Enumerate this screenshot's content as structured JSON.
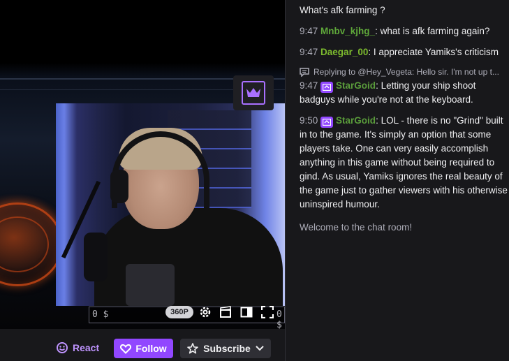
{
  "player": {
    "quality_badge": "360P",
    "hud_left": "0 $",
    "hud_right": "0 $",
    "icons": [
      "crown-icon",
      "gear-icon",
      "clip-icon",
      "theatre-mode-icon",
      "fullscreen-icon"
    ]
  },
  "actions": {
    "react_label": "React",
    "follow_label": "Follow",
    "subscribe_label": "Subscribe"
  },
  "chat": {
    "messages": [
      {
        "text": "What's afk farming ?"
      },
      {
        "time": "9:47",
        "user": "Mnbv_kjhg_",
        "text": ": what is afk farming again?"
      },
      {
        "time": "9:47",
        "user": "Daegar_00",
        "text": ": I appreciate Yamiks's criticism"
      },
      {
        "reply": "Replying to @Hey_Vegeta: Hello sir. I'm not up t..."
      },
      {
        "time": "9:47",
        "user": "StarGoid",
        "text": ": Letting your ship shoot badguys while you're not at the keyboard."
      },
      {
        "time": "9:50",
        "user": "StarGoid",
        "text": ": LOL - there is no \"Grind\" built in to the game. It's simply an option that some players take. One can very easily accomplish anything in this game without being required to gind. As usual, Yamiks ignores the real beauty of the game just to gather viewers with his otherwise uninspired humour."
      }
    ],
    "welcome": "Welcome to the chat room!"
  },
  "colors": {
    "accent": "#9147ff",
    "accent_light": "#bf94ff",
    "chat_bg": "#18181b",
    "username_green": "#5fa83a"
  }
}
